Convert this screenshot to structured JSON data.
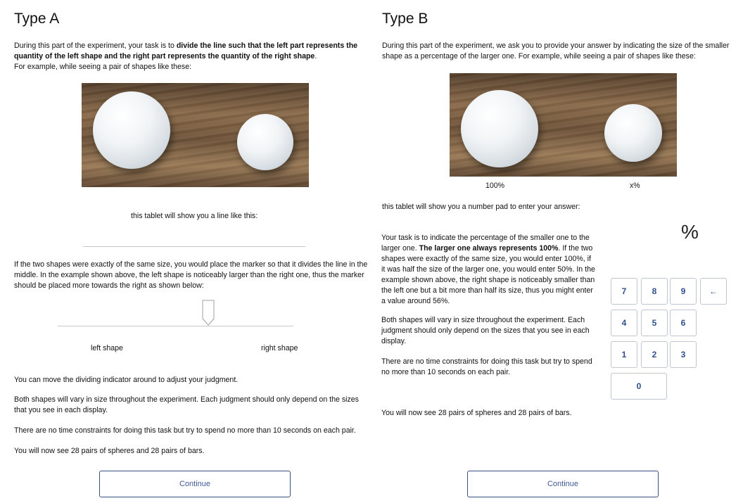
{
  "type_a": {
    "title": "Type A",
    "intro_1": "During this part of the experiment, your task is to ",
    "intro_bold": "divide the line such that the left part represents the quantity of the left shape and the right part represents the quantity of the right shape",
    "intro_2": ".",
    "intro_3": "For example, while seeing a pair of shapes like these:",
    "tablet_line": "this tablet will show you a line like this:",
    "explanation": "If the two shapes were exactly of the same size, you would place the marker so that it divides the line in the middle. In the example shown above, the left shape is noticeably larger than the right one, thus the marker should be placed more towards the right as shown below:",
    "left_label": "left shape",
    "right_label": "right shape",
    "move_text": "You can move the dividing indicator around to adjust your judgment.",
    "vary_text": "Both shapes will vary in size throughout the experiment. Each judgment should only depend on the sizes that you see in each display.",
    "time_text": "There are no time constraints for doing this task but try to spend no more than 10 seconds on each pair.",
    "pairs_text": "You will now see 28 pairs of spheres and 28 pairs of bars.",
    "continue_label": "Continue"
  },
  "type_b": {
    "title": "Type B",
    "intro": "During this part of the experiment, we ask you to provide your answer by indicating the size of the smaller shape as a percentage of the larger one. For example, while seeing a pair of shapes like these:",
    "label_left": "100%",
    "label_right": "x%",
    "tablet_pad": "this tablet will show you a number pad to enter your answer:",
    "task_1": "Your task is to indicate the percentage of the smaller one to the larger one. ",
    "task_bold": "The larger one always represents 100%",
    "task_2": ". If the two shapes were exactly of the same size, you would enter 100%, if it was half the size of the larger one, you would enter 50%. In the example shown above, the right shape is noticeably smaller than the left one but a bit more than half its size, thus you might enter a value around 56%.",
    "vary_text": "Both shapes will vary in size throughout the experiment. Each judgment should only depend on the sizes that you see in each display.",
    "time_text": "There are no time constraints for doing this task but try to spend no more than 10 seconds on each pair.",
    "pairs_text": "You will now see 28 pairs of spheres and 28 pairs of bars.",
    "percent_symbol": "%",
    "keypad": {
      "k7": "7",
      "k8": "8",
      "k9": "9",
      "backspace": "←",
      "k4": "4",
      "k5": "5",
      "k6": "6",
      "k1": "1",
      "k2": "2",
      "k3": "3",
      "k0": "0"
    },
    "continue_label": "Continue"
  },
  "colors": {
    "button_border": "#3a4f86",
    "button_text": "#3d5a99",
    "key_text": "#2f4f8a"
  }
}
